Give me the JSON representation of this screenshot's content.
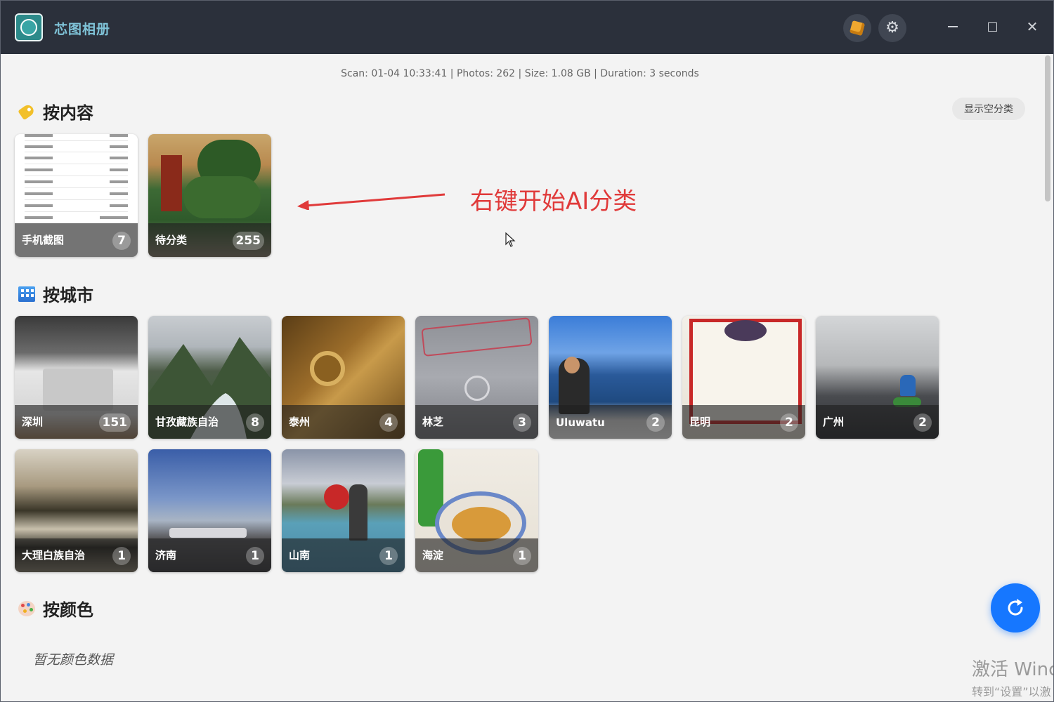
{
  "app": {
    "title": "芯图相册"
  },
  "scan_info": "Scan: 01-04 10:33:41 | Photos: 262 | Size: 1.08 GB | Duration: 3 seconds",
  "sections": {
    "content": {
      "title": "按内容",
      "show_empty_label": "显示空分类"
    },
    "city": {
      "title": "按城市"
    },
    "color": {
      "title": "按颜色",
      "empty_text": "暂无颜色数据"
    }
  },
  "content_tiles": [
    {
      "name": "手机截图",
      "count": "7"
    },
    {
      "name": "待分类",
      "count": "255"
    }
  ],
  "city_tiles": [
    {
      "name": "深圳",
      "count": "151"
    },
    {
      "name": "甘孜藏族自治",
      "count": "8"
    },
    {
      "name": "泰州",
      "count": "4"
    },
    {
      "name": "林芝",
      "count": "3"
    },
    {
      "name": "Uluwatu",
      "count": "2"
    },
    {
      "name": "昆明",
      "count": "2"
    },
    {
      "name": "广州",
      "count": "2"
    },
    {
      "name": "大理白族自治",
      "count": "1"
    },
    {
      "name": "济南",
      "count": "1"
    },
    {
      "name": "山南",
      "count": "1"
    },
    {
      "name": "海淀",
      "count": "1"
    }
  ],
  "annotation": "右键开始AI分类",
  "watermark": {
    "line1": "激活 Winc",
    "line2": "转到“设置”以激"
  },
  "icons": {
    "box": "package-icon",
    "settings": "gear-icon",
    "refresh": "refresh-icon",
    "content": "tag-icon",
    "city": "city-icon",
    "color": "palette-icon"
  },
  "colors": {
    "titlebar": "#2b303b",
    "accent": "#1677ff",
    "annotation": "#e03a3a"
  }
}
